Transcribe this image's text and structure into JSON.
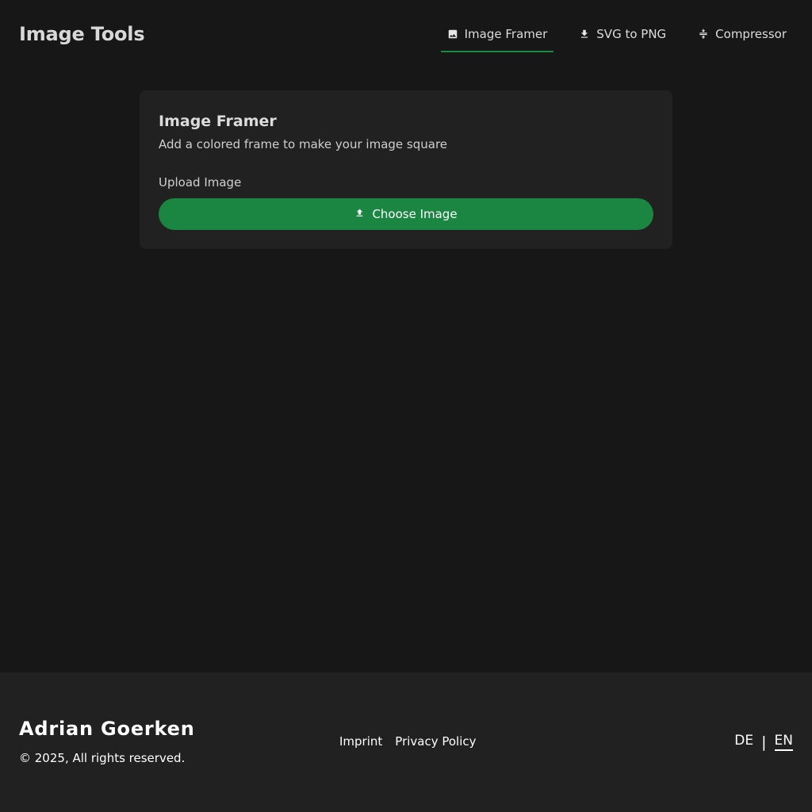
{
  "header": {
    "title": "Image Tools",
    "tabs": [
      {
        "label": "Image Framer",
        "icon": "image-icon",
        "active": true
      },
      {
        "label": "SVG to PNG",
        "icon": "download-icon",
        "active": false
      },
      {
        "label": "Compressor",
        "icon": "compress-icon",
        "active": false
      }
    ]
  },
  "card": {
    "title": "Image Framer",
    "subtitle": "Add a colored frame to make your image square",
    "upload_label": "Upload Image",
    "button_label": "Choose Image",
    "button_icon": "upload-icon"
  },
  "footer": {
    "name": "Adrian Goerken",
    "copyright": "© 2025, All rights reserved.",
    "links": [
      "Imprint",
      "Privacy Policy"
    ],
    "languages": [
      "DE",
      "EN"
    ],
    "language_separator": "|",
    "active_language": "EN"
  },
  "colors": {
    "background": "#171717",
    "surface": "#212121",
    "accent": "#1b8542",
    "text": "#dcdcdc"
  }
}
